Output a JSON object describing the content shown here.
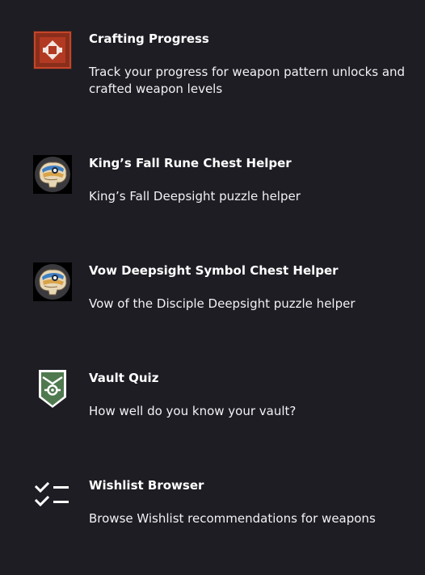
{
  "tools": [
    {
      "title": "Crafting Progress",
      "description": "Track your progress for weapon pattern unlocks and crafted weapon levels",
      "icon": "crafting-icon"
    },
    {
      "title": "King’s Fall Rune Chest Helper",
      "description": "King’s Fall Deepsight puzzle helper",
      "icon": "deepsight-brain-icon"
    },
    {
      "title": "Vow Deepsight Symbol Chest Helper",
      "description": "Vow of the Disciple Deepsight puzzle helper",
      "icon": "deepsight-brain-icon"
    },
    {
      "title": "Vault Quiz",
      "description": "How well do you know your vault?",
      "icon": "vault-shield-icon"
    },
    {
      "title": "Wishlist Browser",
      "description": "Browse Wishlist recommendations for weapons",
      "icon": "checklist-icon"
    }
  ],
  "colors": {
    "background": "#1e1d24",
    "text": "#ffffff",
    "crafting_red": "#a8351f",
    "vault_green": "#4f7a4f"
  }
}
